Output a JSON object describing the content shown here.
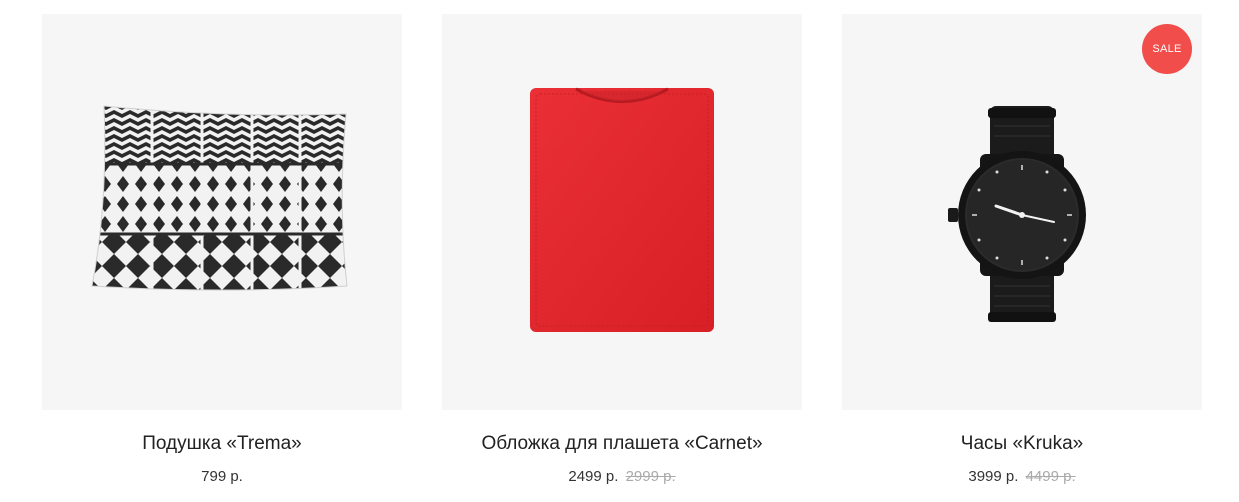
{
  "products": [
    {
      "title": "Подушка «Trema»",
      "price": "799 р.",
      "old_price": "",
      "image": "pillow-image"
    },
    {
      "title": "Обложка для плашета «Carnet»",
      "price": "2499 р.",
      "old_price": "2999 р.",
      "image": "tablet-cover-image"
    },
    {
      "title": "Часы «Kruka»",
      "price": "3999 р.",
      "old_price": "4499 р.",
      "badge": "SALE",
      "image": "watch-image"
    }
  ],
  "colors": {
    "card_background": "#f6f6f6",
    "sale_badge": "#f04d4b",
    "old_price": "#aaaaaa",
    "cover_red": "#e4262c"
  }
}
